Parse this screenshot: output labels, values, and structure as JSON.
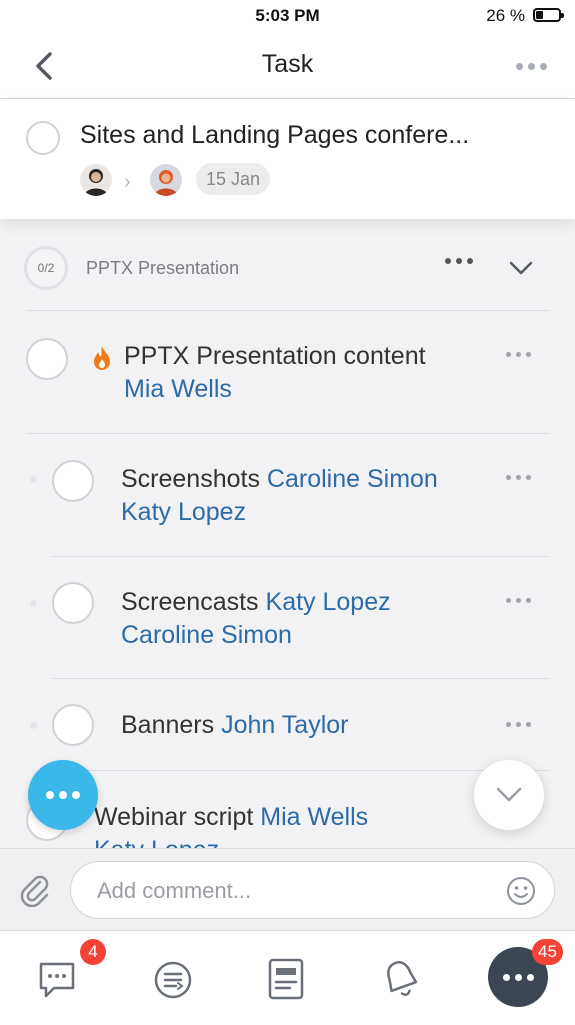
{
  "status_bar": {
    "time": "5:03 PM",
    "battery": "26 %"
  },
  "nav": {
    "title": "Task",
    "back_icon": "chevron-left-icon",
    "more_icon": "more-horizontal-icon"
  },
  "task": {
    "title": "Sites and Landing Pages confere...",
    "due_date": "15 Jan"
  },
  "section": {
    "progress": "0/2",
    "title": "PPTX Presentation"
  },
  "rows": [
    {
      "title": "PPTX Presentation content",
      "people": [
        "Mia Wells"
      ],
      "icon": "fire-icon"
    },
    {
      "title": "Screenshots",
      "people": [
        "Caroline Simon",
        "Katy Lopez"
      ]
    },
    {
      "title": "Screencasts",
      "people": [
        "Katy Lopez",
        "Caroline Simon"
      ]
    },
    {
      "title": "Banners",
      "people": [
        "John Taylor"
      ]
    },
    {
      "title": "Webinar script",
      "people": [
        "Mia Wells",
        "Katy Lopez"
      ]
    }
  ],
  "comment": {
    "placeholder": "Add comment..."
  },
  "tabbar": {
    "chat_badge": "4",
    "more_badge": "45"
  },
  "colors": {
    "accent": "#3bb8ea",
    "person_link": "#2e6aa8",
    "badge": "#f44336",
    "fire": "#f07a1a"
  }
}
